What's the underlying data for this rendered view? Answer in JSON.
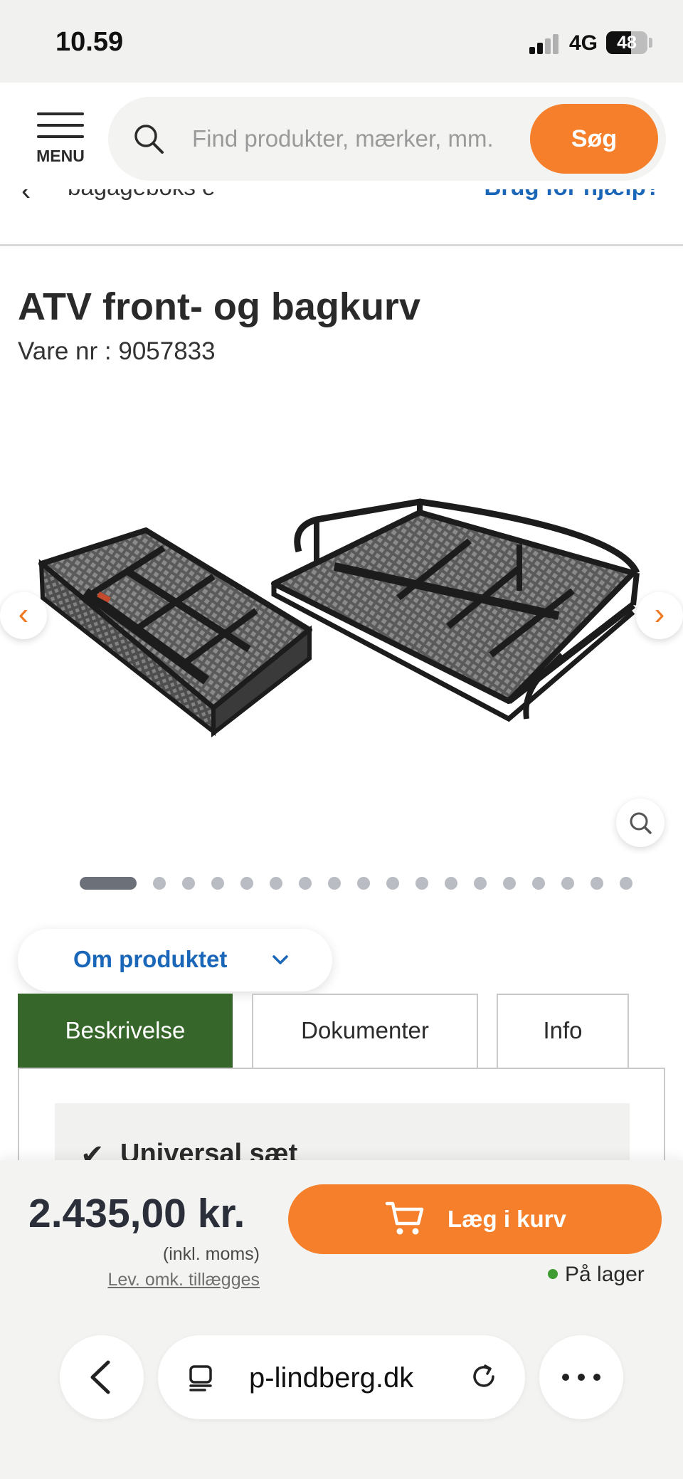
{
  "status_bar": {
    "time": "10.59",
    "network": "4G",
    "battery": "48"
  },
  "header": {
    "menu_label": "MENU",
    "search_placeholder": "Find produkter, mærker, mm.",
    "search_button": "Søg"
  },
  "breadcrumb": {
    "text": "bagageboks e",
    "help_link": "Brug for hjælp?"
  },
  "product": {
    "title": "ATV front- og bagkurv",
    "sku_label": "Vare nr : ",
    "sku": "9057833",
    "image_count": 18,
    "active_image": 1
  },
  "about": {
    "label": "Om produktet"
  },
  "tabs": [
    {
      "label": "Beskrivelse",
      "active": true
    },
    {
      "label": "Dokumenter",
      "active": false
    },
    {
      "label": "Info",
      "active": false
    }
  ],
  "description": {
    "first_feature": "Universal sæt"
  },
  "cart": {
    "price": "2.435,00 kr.",
    "vat_note": "(inkl. moms)",
    "shipping_note": "Lev. omk. tillægges",
    "add_to_cart": "Læg i kurv",
    "stock_status": "På lager"
  },
  "browser": {
    "url": "p-lindberg.dk"
  },
  "colors": {
    "accent_orange": "#f57f2a",
    "tab_active_green": "#37662b",
    "link_blue": "#1a66b8",
    "in_stock_green": "#3f9c32"
  },
  "icons": [
    "menu-icon",
    "search-icon",
    "chevron-left-icon",
    "chevron-right-icon",
    "zoom-icon",
    "chevron-down-icon",
    "check-icon",
    "cart-icon",
    "back-icon",
    "tabs-icon",
    "reload-icon",
    "more-icon"
  ]
}
